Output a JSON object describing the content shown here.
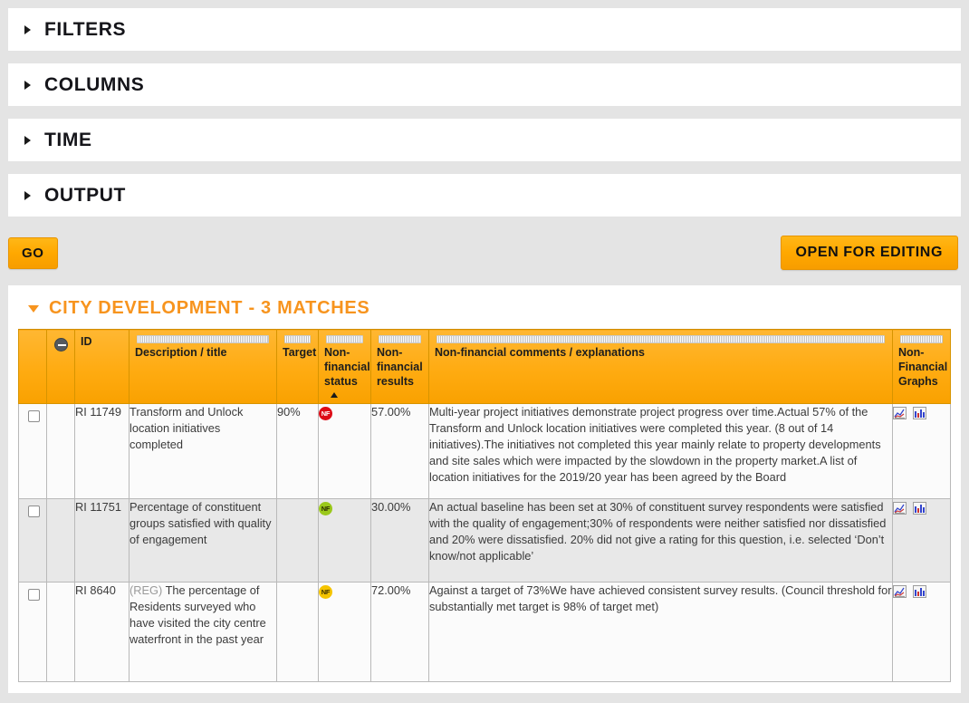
{
  "accordion": {
    "panels": [
      {
        "label": "FILTERS",
        "icon": "triangle-right-icon"
      },
      {
        "label": "COLUMNS",
        "icon": "triangle-right-icon"
      },
      {
        "label": "TIME",
        "icon": "triangle-right-icon"
      },
      {
        "label": "OUTPUT",
        "icon": "triangle-right-icon"
      }
    ]
  },
  "actions": {
    "go_label": "GO",
    "open_for_editing_label": "OPEN FOR EDITING"
  },
  "results": {
    "title": "CITY DEVELOPMENT - 3 MATCHES",
    "caret_icon": "triangle-down-icon",
    "accent_color": "#f7941e",
    "header_color": "#ffab11",
    "columns": [
      {
        "key": "check",
        "label": "",
        "grip": false
      },
      {
        "key": "collapse",
        "label": "",
        "grip": false,
        "icon": "minus-circle-icon"
      },
      {
        "key": "id",
        "label": "ID",
        "grip": false
      },
      {
        "key": "desc",
        "label": "Description / title",
        "grip": true
      },
      {
        "key": "target",
        "label": "Target",
        "grip": true
      },
      {
        "key": "status",
        "label": "Non-financial status",
        "grip": true,
        "sort": "asc"
      },
      {
        "key": "results",
        "label": "Non-financial results",
        "grip": true
      },
      {
        "key": "comments",
        "label": "Non-financial comments / explanations",
        "grip": true
      },
      {
        "key": "graphs",
        "label": "Non-Financial Graphs",
        "grip": true
      }
    ],
    "rows": [
      {
        "id": "RI 11749",
        "reg": "",
        "description": "Transform and Unlock location initiatives completed",
        "target": "90%",
        "status": "NF",
        "status_color": "red",
        "results": "57.00%",
        "comments": "Multi-year project initiatives demonstrate project progress over time.Actual 57% of the Transform and Unlock location initiatives were completed this year. (8 out of 14 initiatives).The initiatives not completed this year mainly relate to property developments and site sales which were impacted by the slowdown in the property market.A list of location initiatives for the 2019/20 year has been agreed by the Board",
        "graphs": [
          "line-chart-icon",
          "bar-chart-icon"
        ]
      },
      {
        "id": "RI 11751",
        "reg": "",
        "description": "Percentage of constituent groups satisfied with quality of engagement",
        "target": "",
        "status": "NF",
        "status_color": "green",
        "results": "30.00%",
        "comments": "An actual baseline has been set at 30% of constituent survey respondents were satisfied with the quality of engagement;30% of respondents were neither satisfied nor dissatisfied and 20% were dissatisfied. 20% did not give a rating for this question, i.e. selected ‘Don’t know/not applicable’",
        "graphs": [
          "line-chart-icon",
          "bar-chart-icon"
        ]
      },
      {
        "id": "RI 8640",
        "reg": "(REG)",
        "description": " The percentage of Residents surveyed who have visited the city centre waterfront in the past year",
        "target": "",
        "status": "NF",
        "status_color": "amber",
        "results": "72.00%",
        "comments": "Against a target of 73%We have achieved consistent survey results. (Council threshold for substantially met target is 98% of target met)",
        "graphs": [
          "line-chart-icon",
          "bar-chart-icon"
        ]
      }
    ]
  }
}
